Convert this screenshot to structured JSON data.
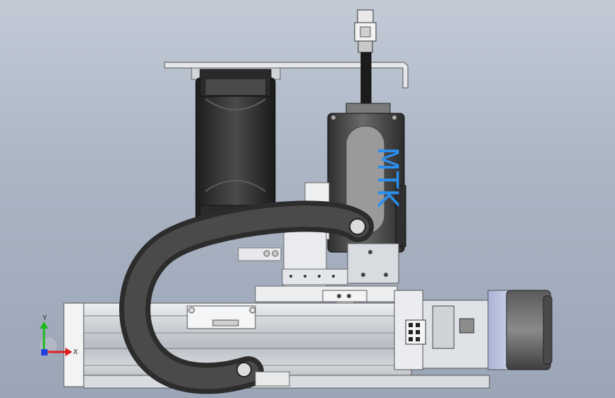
{
  "model": {
    "brand_text": "MTK"
  },
  "triad": {
    "x_label": "X",
    "y_label": "Y"
  },
  "colors": {
    "background_top": "#c2cad6",
    "background_bottom": "#9aa5b6",
    "brand_blue": "#2a8ff0",
    "axis_x": "#e02020",
    "axis_y": "#1eb81e",
    "axis_z": "#2040e0",
    "cable_chain": "#3a3a3a",
    "aluminum": "#d6dade"
  },
  "icons": {
    "triad": "coordinate-triad-icon"
  }
}
